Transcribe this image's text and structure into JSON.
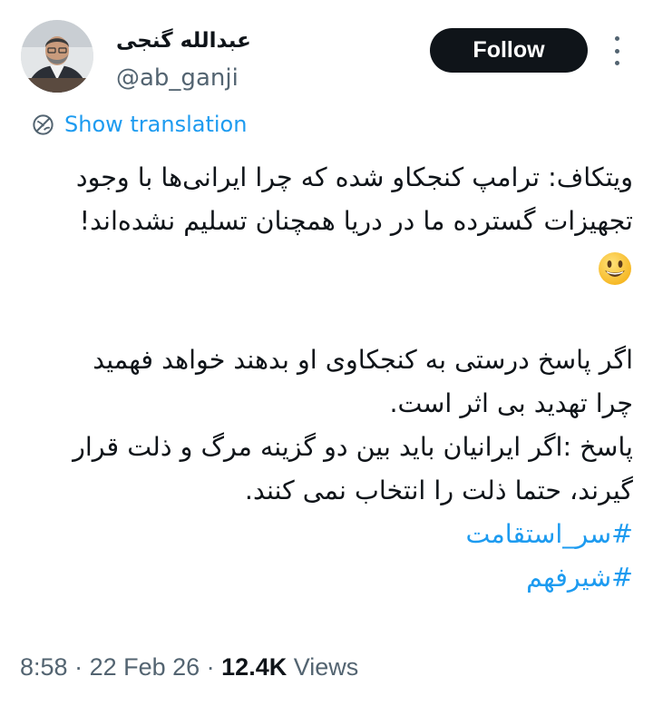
{
  "author": {
    "display_name": "عبدالله گنجی",
    "handle": "@ab_ganji"
  },
  "follow_label": "Follow",
  "translation_label": "Show translation",
  "tweet": {
    "lines": [
      "ویتکاف: ترامپ کنجکاو شده که چرا ایرانی‌ها با وجود",
      "تجهیزات گسترده ما در دریا همچنان تسلیم نشده‌اند!",
      "اگر پاسخ درستی به کنجکاوی او بدهند خواهد فهمید",
      "چرا تهدید بی اثر است.",
      "پاسخ :اگر ایرانیان باید بین دو گزینه مرگ و ذلت قرار",
      "گیرند، حتما ذلت را انتخاب نمی کنند."
    ],
    "emoji": "grinning-face-emoji",
    "hashtags": [
      "#سر_استقامت",
      "#شیرفهم"
    ]
  },
  "meta": {
    "time": "8:58",
    "separator": " · ",
    "date": "22 Feb 26",
    "views_count": "12.4K",
    "views_label": " Views"
  },
  "colors": {
    "link": "#1d9bf0",
    "text": "#0f1419",
    "muted": "#536471",
    "follow_bg": "#0f1419"
  }
}
